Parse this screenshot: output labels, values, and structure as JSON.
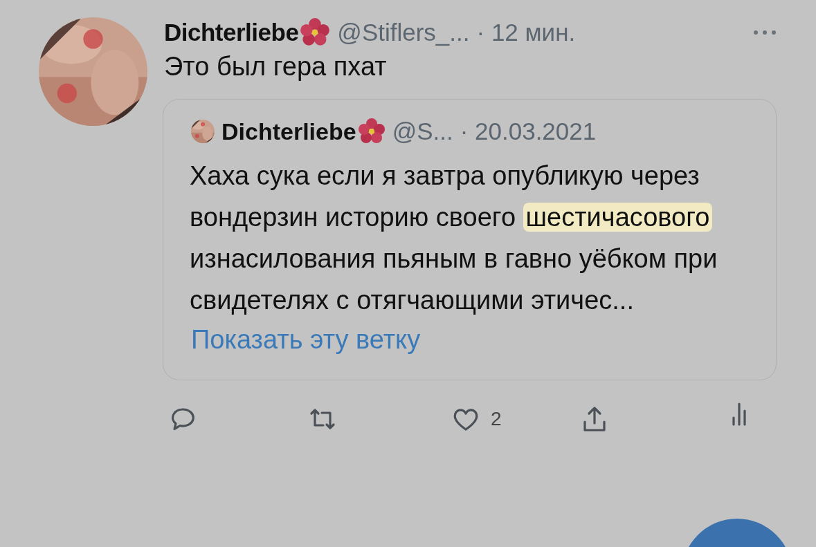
{
  "tweet": {
    "author": "Dichterliebe",
    "handle": "@Stiflers_...",
    "time": "· 12 мин.",
    "text": "Это был гера пхат",
    "quote": {
      "author": "Dichterliebe",
      "handle": "@S...",
      "time": "· 20.03.2021",
      "body": [
        {
          "text": "Хаха сука если я завтра опубликую через вондерзин историю своего ",
          "highlighted": false
        },
        {
          "text": "шестичасового",
          "highlighted": true
        },
        {
          "text": " изнасилования пьяным в гавно уёбком при свидетелях с отягчающими этичес...",
          "highlighted": false
        }
      ],
      "show_thread": "Показать эту ветку"
    },
    "likes": "2"
  }
}
